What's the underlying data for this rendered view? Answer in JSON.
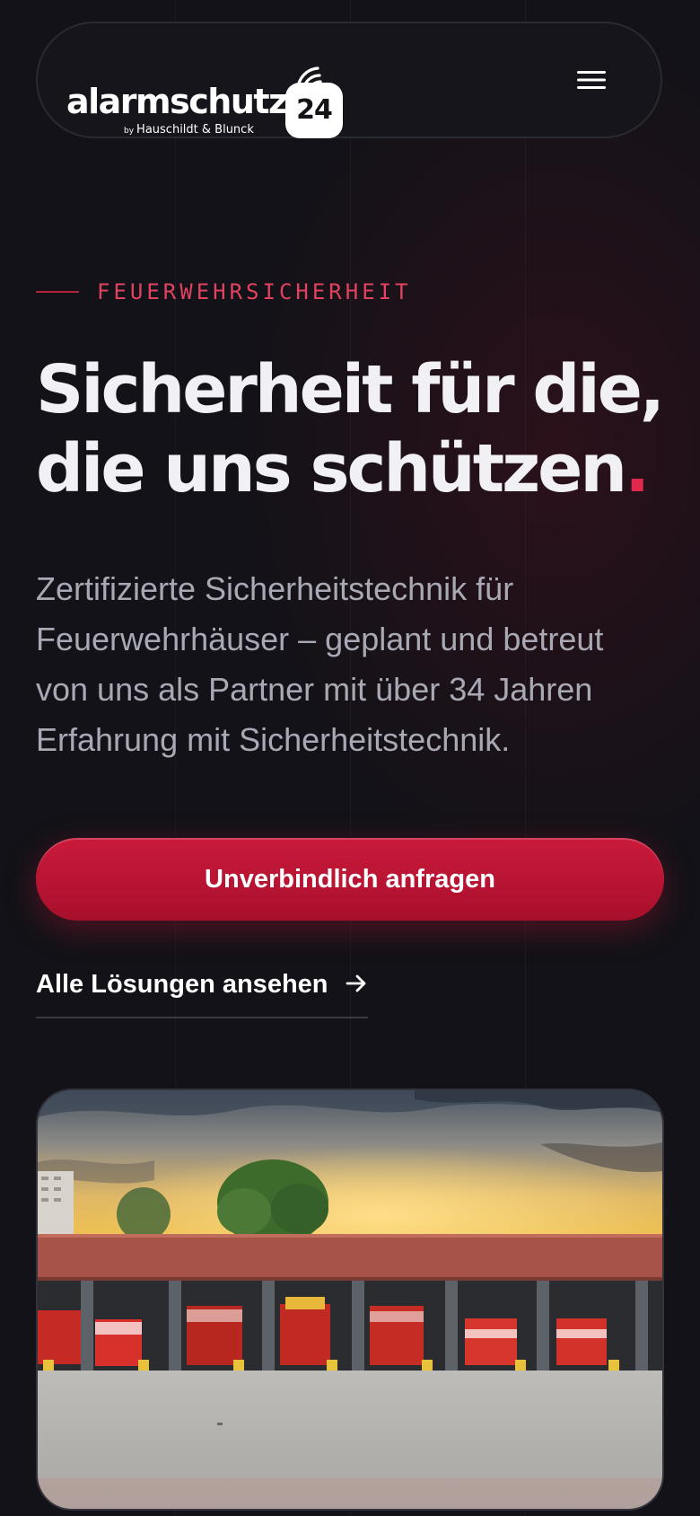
{
  "header": {
    "logo": {
      "wordmark": "alarmschutz",
      "badge": "24",
      "by": "by",
      "tagline": "Hauschildt & Blunck"
    },
    "menu_icon": "hamburger-menu-icon"
  },
  "hero": {
    "eyebrow": "FEUERWEHRSICHERHEIT",
    "headline_line1": "Sicherheit für die,",
    "headline_line2": "die uns schützen",
    "headline_dot": ".",
    "lead": "Zertifizierte Sicherheitstechnik für Feuerwehrhäuser – geplant und betreut von uns als Partner mit über 34 Jahren Erfahrung mit Sicherheitstechnik.",
    "cta_label": "Unverbindlich anfragen",
    "secondary_link_label": "Alle Lösungen ansehen",
    "secondary_link_icon": "arrow-right-icon"
  },
  "colors": {
    "background": "#121218",
    "accent": "#c8173a",
    "eyebrow": "#e0425f",
    "text": "#f1f1f5",
    "muted": "#a9a9b5"
  }
}
